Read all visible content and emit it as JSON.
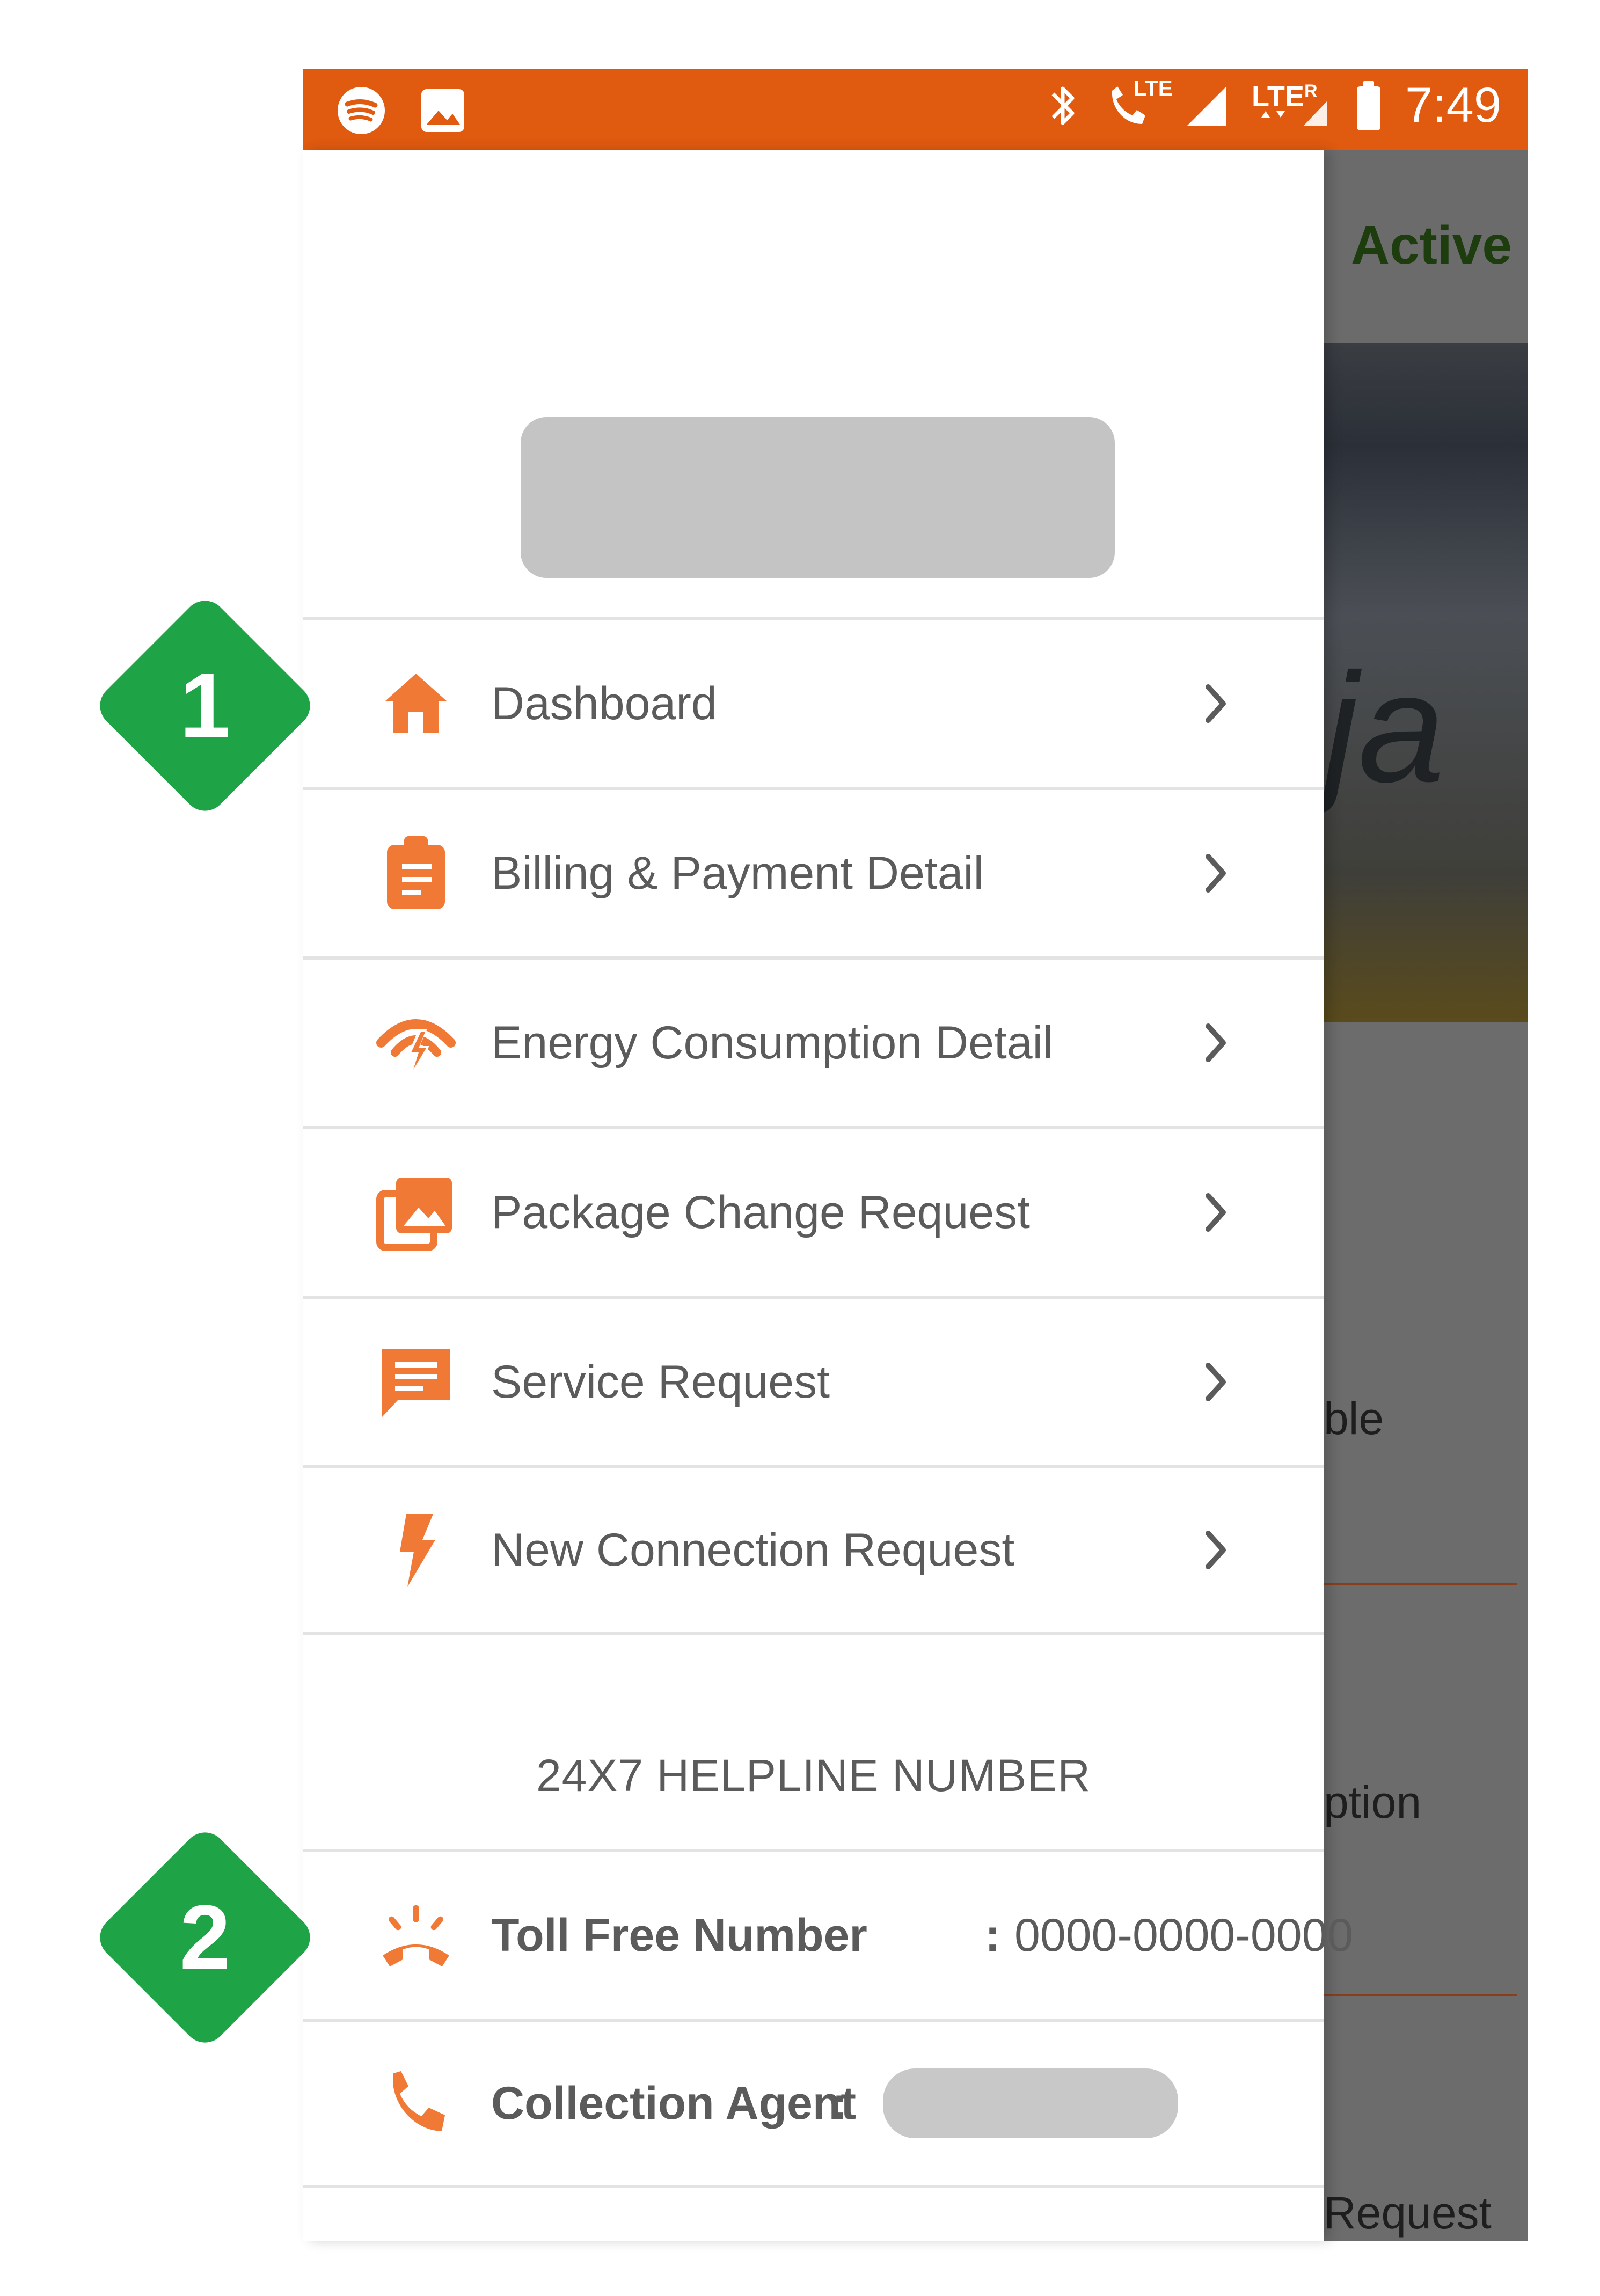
{
  "status_bar": {
    "time": "7:49",
    "left_icons": [
      "spotify-icon",
      "image-icon"
    ],
    "right_icons": [
      "bluetooth-icon",
      "lte-call-icon",
      "signal-icon",
      "lte-data-icon",
      "battery-icon"
    ],
    "lte_label_1": "LTE",
    "lte_label_2": "LTE",
    "roaming_label": "R"
  },
  "background_app": {
    "status": "Active",
    "banner_text": "ja",
    "visible_labels": [
      "ble",
      "ption",
      "Request"
    ]
  },
  "drawer": {
    "menu_items": [
      {
        "label": "Dashboard",
        "icon": "home-icon"
      },
      {
        "label": "Billing & Payment Detail",
        "icon": "clipboard-icon"
      },
      {
        "label": "Energy Consumption Detail",
        "icon": "energy-icon"
      },
      {
        "label": "Package Change Request",
        "icon": "gallery-icon"
      },
      {
        "label": "Service Request",
        "icon": "message-icon"
      },
      {
        "label": "New Connection Request",
        "icon": "lightning-icon"
      }
    ],
    "helpline_title": "24X7 HELPLINE NUMBER",
    "contacts": [
      {
        "label": "Toll Free Number",
        "separator": ":",
        "value": "0000-0000-0000",
        "icon": "ringing-phone-icon"
      },
      {
        "label": "Collection Agent",
        "separator": ":",
        "value": "",
        "icon": "phone-icon"
      }
    ]
  },
  "markers": {
    "one": "1",
    "two": "2"
  },
  "colors": {
    "status_bar": "#E05A10",
    "icon_orange": "#F07A35",
    "marker_green": "#1FA347"
  }
}
